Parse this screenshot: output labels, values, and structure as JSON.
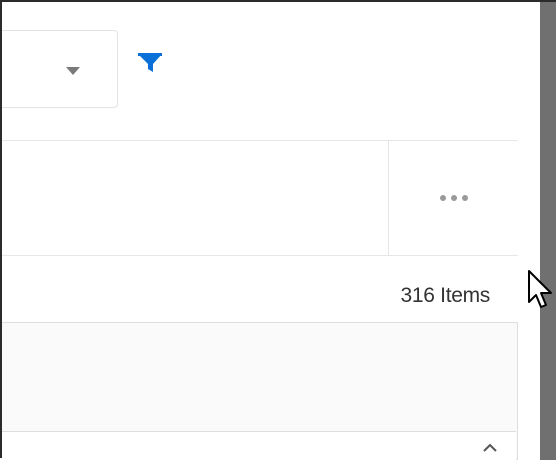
{
  "toolbar": {
    "select_value": "",
    "filter_icon": "filter-icon",
    "filter_color": "#0a6fd6"
  },
  "header": {
    "more_icon": "more-options-icon"
  },
  "summary": {
    "items_label": "316 Items"
  },
  "table": {
    "scroll_icon": "chevron-up-icon"
  },
  "colors": {
    "scrollbar": "#707070",
    "border": "#e6e6e6"
  }
}
